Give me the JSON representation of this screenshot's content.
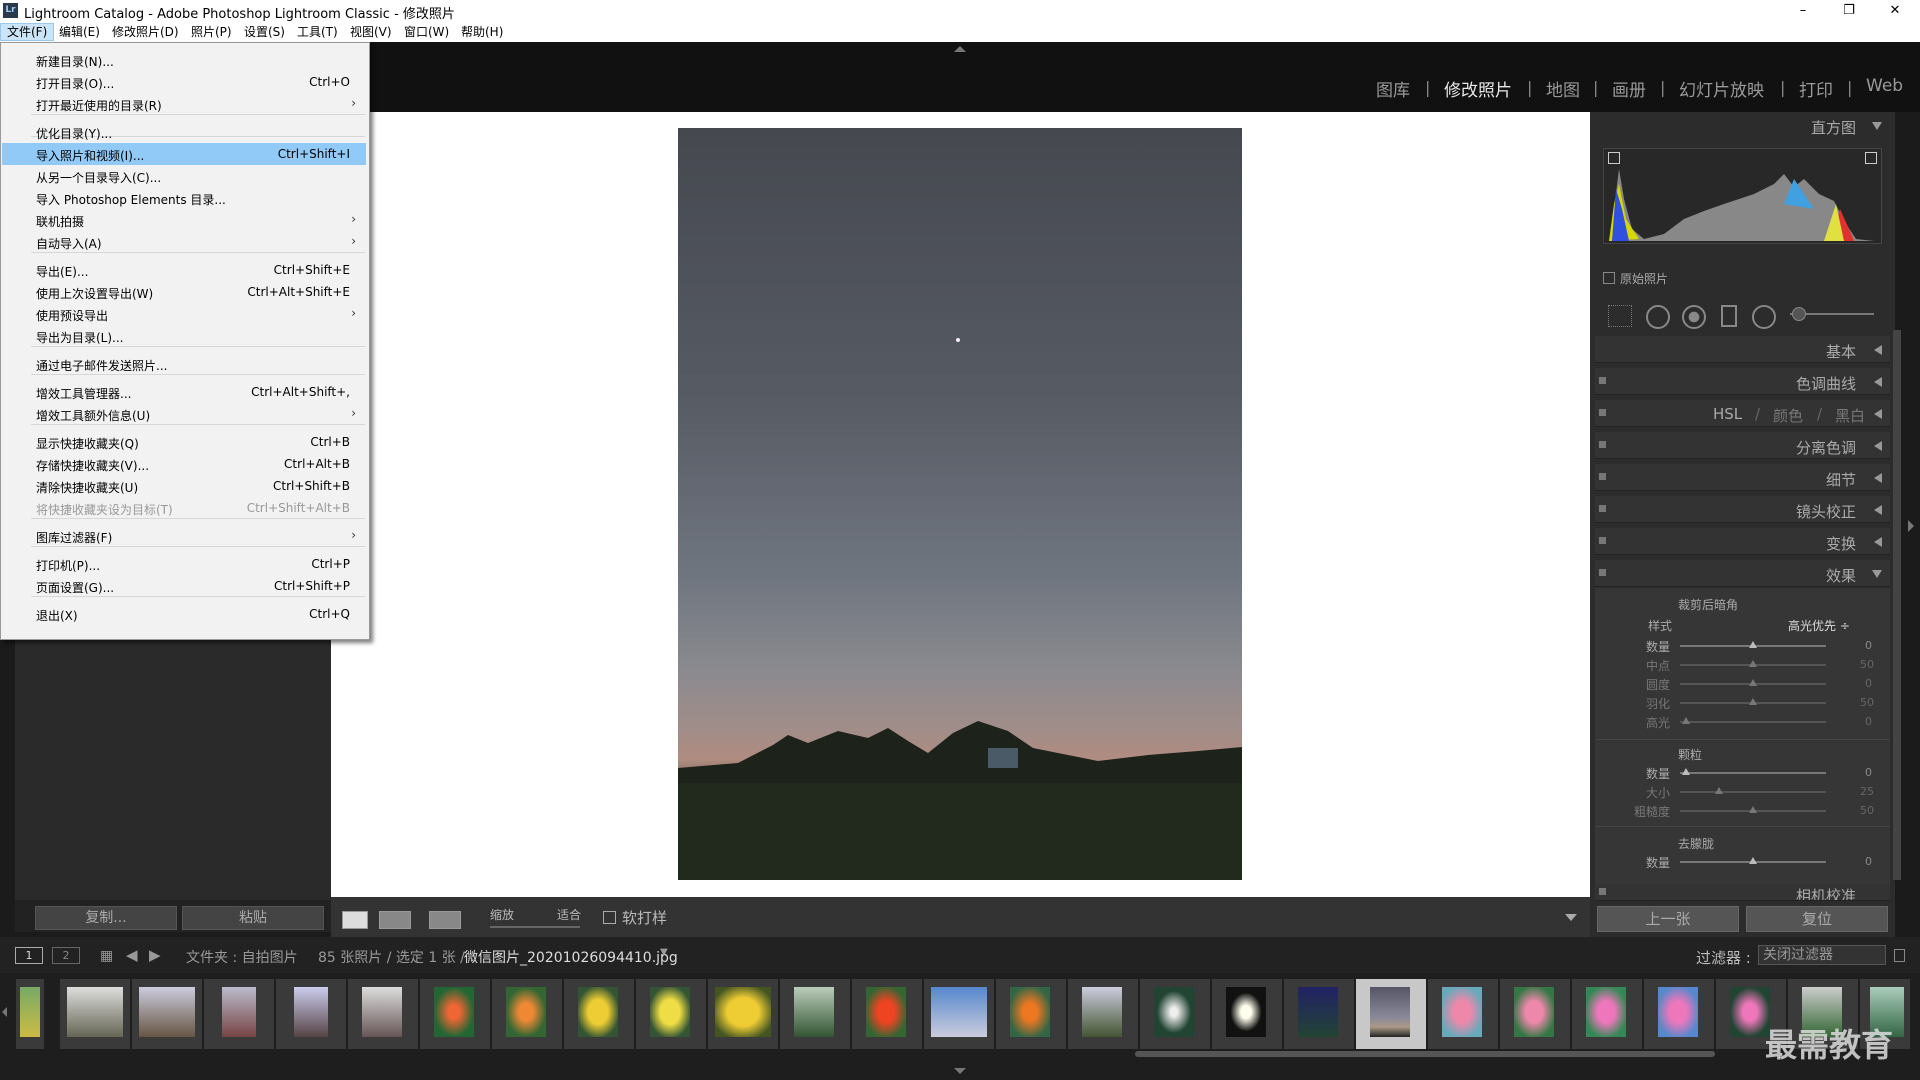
{
  "window": {
    "title": "Lightroom Catalog - Adobe Photoshop Lightroom Classic - 修改照片",
    "logo": "Lr",
    "min": "–",
    "max": "❐",
    "close": "✕"
  },
  "menubar": [
    "文件(F)",
    "编辑(E)",
    "修改照片(D)",
    "照片(P)",
    "设置(S)",
    "工具(T)",
    "视图(V)",
    "窗口(W)",
    "帮助(H)"
  ],
  "modules": [
    "图库",
    "修改照片",
    "地图",
    "画册",
    "幻灯片放映",
    "打印",
    "Web"
  ],
  "file_menu": [
    {
      "label": "新建目录(N)...",
      "shortcut": ""
    },
    {
      "label": "打开目录(O)...",
      "shortcut": "Ctrl+O"
    },
    {
      "label": "打开最近使用的目录(R)",
      "shortcut": "",
      "sub": true
    },
    {
      "label": "优化目录(Y)...",
      "shortcut": ""
    },
    {
      "label": "导入照片和视频(I)...",
      "shortcut": "Ctrl+Shift+I"
    },
    {
      "label": "从另一个目录导入(C)...",
      "shortcut": ""
    },
    {
      "label": "导入 Photoshop Elements 目录...",
      "shortcut": ""
    },
    {
      "label": "联机拍摄",
      "shortcut": "",
      "sub": true
    },
    {
      "label": "自动导入(A)",
      "shortcut": "",
      "sub": true
    },
    {
      "label": "导出(E)...",
      "shortcut": "Ctrl+Shift+E"
    },
    {
      "label": "使用上次设置导出(W)",
      "shortcut": "Ctrl+Alt+Shift+E"
    },
    {
      "label": "使用预设导出",
      "shortcut": "",
      "sub": true
    },
    {
      "label": "导出为目录(L)...",
      "shortcut": ""
    },
    {
      "label": "通过电子邮件发送照片...",
      "shortcut": ""
    },
    {
      "label": "增效工具管理器...",
      "shortcut": "Ctrl+Alt+Shift+,"
    },
    {
      "label": "增效工具额外信息(U)",
      "shortcut": "",
      "sub": true
    },
    {
      "label": "显示快捷收藏夹(Q)",
      "shortcut": "Ctrl+B"
    },
    {
      "label": "存储快捷收藏夹(V)...",
      "shortcut": "Ctrl+Alt+B"
    },
    {
      "label": "清除快捷收藏夹(U)",
      "shortcut": "Ctrl+Shift+B"
    },
    {
      "label": "将快捷收藏夹设为目标(T)",
      "shortcut": "Ctrl+Shift+Alt+B"
    },
    {
      "label": "图库过滤器(F)",
      "shortcut": "",
      "sub": true
    },
    {
      "label": "打印机(P)...",
      "shortcut": "Ctrl+P"
    },
    {
      "label": "页面设置(G)...",
      "shortcut": "Ctrl+Shift+P"
    },
    {
      "label": "退出(X)",
      "shortcut": "Ctrl+Q"
    }
  ],
  "left": {
    "copy": "复制...",
    "paste": "粘贴"
  },
  "toolbar": {
    "zoom": "缩放",
    "fit": "适合",
    "softproof": "软打样"
  },
  "right": {
    "histogram": "直方图",
    "original": "原始照片",
    "sections": [
      "基本",
      "色调曲线",
      "分离色调",
      "细节",
      "镜头校正",
      "变换",
      "效果",
      "相机校准"
    ],
    "hsl": [
      "HSL",
      "颜色",
      "黑白"
    ],
    "vignette": {
      "title": "裁剪后暗角",
      "style_label": "样式",
      "style_value": "高光优先 ÷",
      "rows": [
        {
          "l": "数量",
          "v": "0"
        },
        {
          "l": "中点",
          "v": "50"
        },
        {
          "l": "圆度",
          "v": "0"
        },
        {
          "l": "羽化",
          "v": "50"
        },
        {
          "l": "高光",
          "v": "0"
        }
      ]
    },
    "grain": {
      "title": "颗粒",
      "rows": [
        {
          "l": "数量",
          "v": "0"
        },
        {
          "l": "大小",
          "v": "25"
        },
        {
          "l": "粗糙度",
          "v": "50"
        }
      ]
    },
    "dehaze": {
      "title": "去朦胧",
      "rows": [
        {
          "l": "数量",
          "v": "0"
        }
      ]
    },
    "prev": "上一张",
    "reset": "复位"
  },
  "filmhead": {
    "page1": "1",
    "page2": "2",
    "path": "文件夹 : 自拍图片",
    "count": "85 张照片 / 选定 1 张 /",
    "filename": "微信图片_20201026094410.jpg",
    "filter_label": "过滤器 :",
    "filter_value": "关闭过滤器"
  },
  "watermark": "最需教育"
}
